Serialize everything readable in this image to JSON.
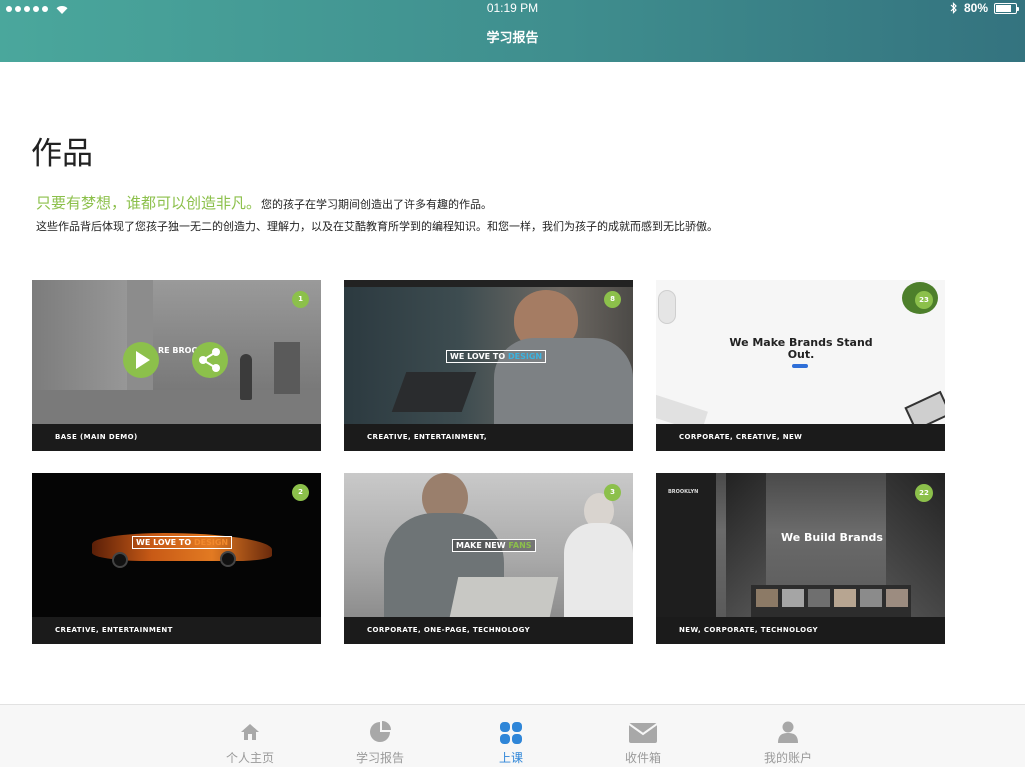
{
  "status_bar": {
    "time": "01:19 PM",
    "battery": "80%",
    "battery_level": 0.8
  },
  "header": {
    "title": "学习报告"
  },
  "main": {
    "title": "作品",
    "slogan": "只要有梦想，谁都可以创造非凡。",
    "intro_rest": "您的孩子在学习期间创造出了许多有趣的作品。",
    "intro_line2": "这些作品背后体现了您孩子独一无二的创造力、理解力，以及在艾酷教育所学到的编程知识。和您一样，我们为孩子的成就而感到无比骄傲。"
  },
  "works": [
    {
      "caption": "BASE (MAIN DEMO)",
      "badge": "1",
      "hero": "RE BROO"
    },
    {
      "caption": "CREATIVE, ENTERTAINMENT,",
      "badge": "8",
      "hero_a": "WE LOVE TO ",
      "hero_b": "DESIGN"
    },
    {
      "caption": "CORPORATE, CREATIVE, NEW",
      "badge": "23",
      "hero": "We Make Brands Stand Out."
    },
    {
      "caption": "CREATIVE, ENTERTAINMENT",
      "badge": "2",
      "hero_a": "WE LOVE TO ",
      "hero_b": "DESIGN"
    },
    {
      "caption": "CORPORATE, ONE-PAGE, TECHNOLOGY",
      "badge": "3",
      "hero_a": "MAKE NEW ",
      "hero_b": "FANS"
    },
    {
      "caption": "NEW, CORPORATE, TECHNOLOGY",
      "badge": "22",
      "hero": "We Build Brands",
      "logo": "BROOKLYN"
    }
  ],
  "tabbar": {
    "items": [
      {
        "label": "个人主页",
        "icon": "home-icon"
      },
      {
        "label": "学习报告",
        "icon": "pie-chart-icon"
      },
      {
        "label": "上课",
        "icon": "grid-icon",
        "active": true
      },
      {
        "label": "收件箱",
        "icon": "mail-icon"
      },
      {
        "label": "我的账户",
        "icon": "user-icon"
      }
    ]
  },
  "colors": {
    "accent_green": "#8cc04b",
    "tab_active": "#2f86d8",
    "header_start": "#4aa79c",
    "header_end": "#34737f"
  }
}
